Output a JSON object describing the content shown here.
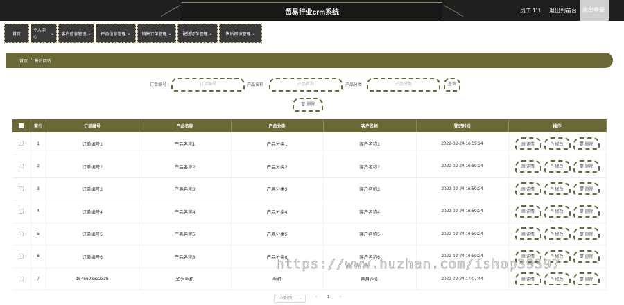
{
  "header": {
    "title": "贸易行业crm系统",
    "user": "员工 111",
    "back_label": "退出到前台",
    "logout_label": "退出登录"
  },
  "nav": {
    "items": [
      {
        "label": "首页",
        "has_chevron": false
      },
      {
        "label": "个人中心",
        "has_chevron": true
      },
      {
        "label": "客户信息管理",
        "has_chevron": true
      },
      {
        "label": "产品信息管理",
        "has_chevron": true
      },
      {
        "label": "销售订单管理",
        "has_chevron": true
      },
      {
        "label": "配送订单管理",
        "has_chevron": true
      },
      {
        "label": "售后回访管理",
        "has_chevron": true
      }
    ]
  },
  "breadcrumb": {
    "home": "首页",
    "separator": "/",
    "current": "售后回访"
  },
  "search": {
    "order_label": "订单编号",
    "order_placeholder": "订单编号",
    "product_label": "产品名称",
    "product_placeholder": "产品名称",
    "category_label": "产品分类",
    "category_placeholder": "产品分类",
    "query_button": "查询",
    "delete_button": "删除"
  },
  "table": {
    "columns": [
      "索引",
      "订单编号",
      "产品名称",
      "产品分类",
      "客户名称",
      "登记时间",
      "操作"
    ],
    "rows": [
      {
        "index": "1",
        "order": "订单编号1",
        "product": "产品名称1",
        "category": "产品分类1",
        "customer": "客户名称1",
        "time": "2022-02-24 16:59:24"
      },
      {
        "index": "2",
        "order": "订单编号2",
        "product": "产品名称2",
        "category": "产品分类2",
        "customer": "客户名称2",
        "time": "2022-02-24 16:59:24"
      },
      {
        "index": "3",
        "order": "订单编号3",
        "product": "产品名称3",
        "category": "产品分类3",
        "customer": "客户名称3",
        "time": "2022-02-24 16:59:24"
      },
      {
        "index": "4",
        "order": "订单编号4",
        "product": "产品名称4",
        "category": "产品分类4",
        "customer": "客户名称4",
        "time": "2022-02-24 16:59:24"
      },
      {
        "index": "5",
        "order": "订单编号5",
        "product": "产品名称5",
        "category": "产品分类5",
        "customer": "客户名称5",
        "time": "2022-02-24 16:59:24"
      },
      {
        "index": "6",
        "order": "订单编号6",
        "product": "产品名称6",
        "category": "产品分类6",
        "customer": "客户名称6",
        "time": "2022-02-24 16:59:24"
      },
      {
        "index": "7",
        "order": "1645693622336",
        "product": "华为手机",
        "category": "手机",
        "customer": "月月企业",
        "time": "2022-02-24 17:07:44"
      }
    ],
    "actions": {
      "detail": "详情",
      "edit": "修改",
      "delete": "删除"
    }
  },
  "pager": {
    "page_size": "10条/页",
    "current_page": "1",
    "prev": "‹",
    "next": "›"
  },
  "watermark": "https://www.huzhan.com/ishop39397",
  "colors": {
    "accent": "#6b6838",
    "topbar": "#1f1f1f"
  }
}
